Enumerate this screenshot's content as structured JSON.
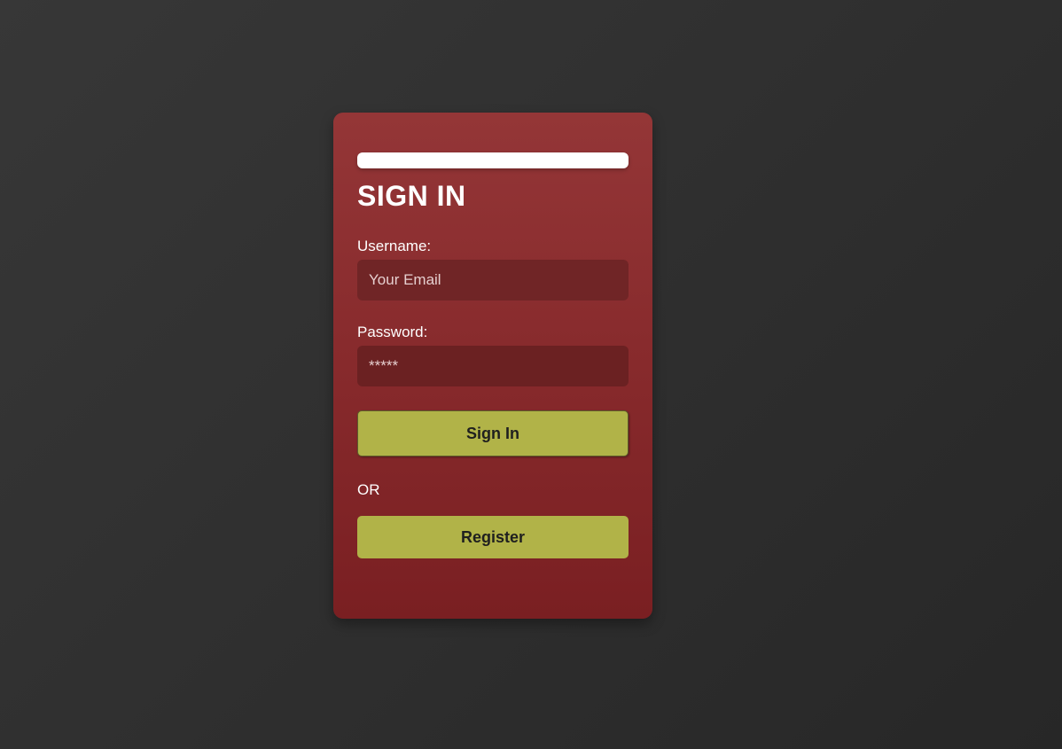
{
  "form": {
    "title": "SIGN IN",
    "username_label": "Username:",
    "username_placeholder": "Your Email",
    "password_label": "Password:",
    "password_placeholder": "*****",
    "signin_label": "Sign In",
    "or_text": "OR",
    "register_label": "Register"
  },
  "colors": {
    "background": "#303030",
    "card": "#8a2c2d",
    "button": "#b1b348",
    "input": "#702526"
  }
}
